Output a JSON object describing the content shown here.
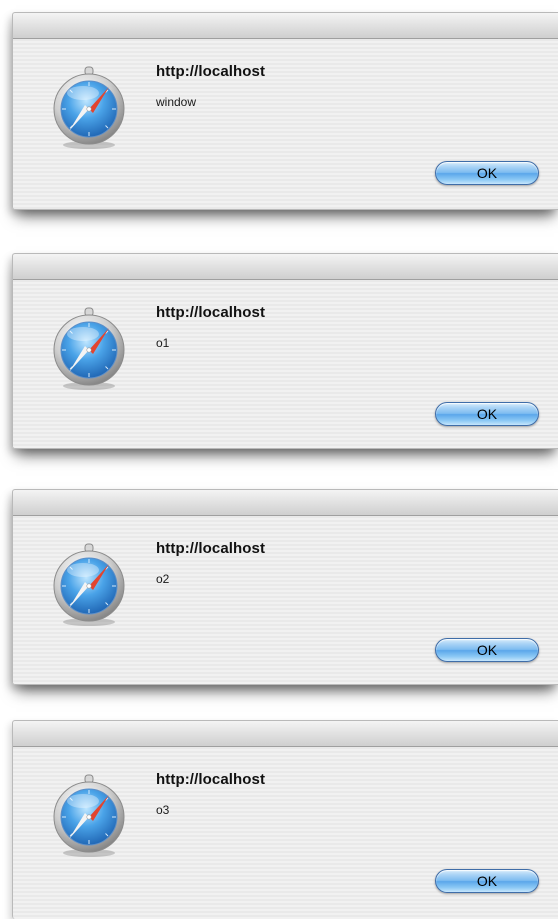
{
  "dialogs": [
    {
      "title": "http://localhost",
      "message": "window",
      "ok_label": "OK"
    },
    {
      "title": "http://localhost",
      "message": "o1",
      "ok_label": "OK"
    },
    {
      "title": "http://localhost",
      "message": "o2",
      "ok_label": "OK"
    },
    {
      "title": "http://localhost",
      "message": "o3",
      "ok_label": "OK"
    }
  ],
  "icon": "safari-compass-icon",
  "colors": {
    "button_blue": "#7dbcf0",
    "compass_red": "#d93b2b",
    "icon_blue": "#2f79c9"
  }
}
